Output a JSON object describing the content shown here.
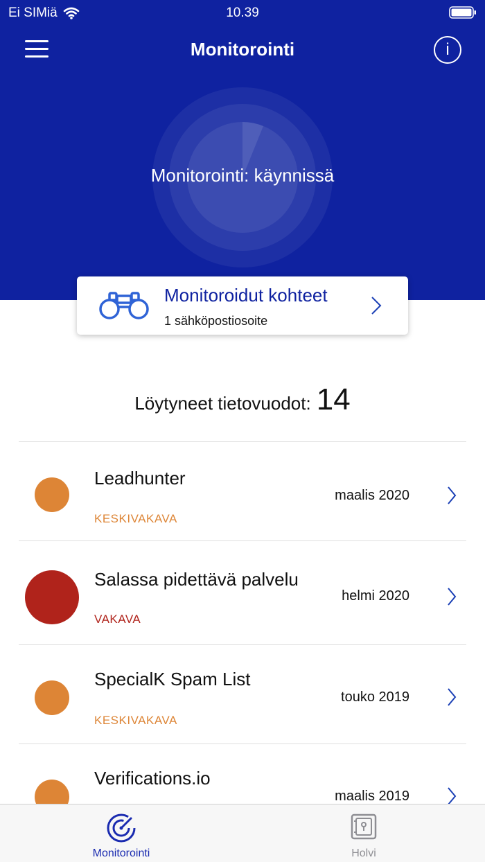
{
  "status_bar": {
    "carrier": "Ei SIMiä",
    "time": "10.39"
  },
  "nav": {
    "title": "Monitorointi"
  },
  "monitoring": {
    "status_text": "Monitorointi: käynnissä"
  },
  "monitored_items": {
    "title": "Monitoroidut kohteet",
    "subtitle": "1 sähköpostiosoite"
  },
  "breaches": {
    "label": "Löytyneet tietovuodot:",
    "count": "14",
    "items": [
      {
        "name": "Leadhunter",
        "severity": "KESKIVAKAVA",
        "date": "maalis 2020",
        "severity_color": "#dd8536"
      },
      {
        "name": "Salassa pidettävä palvelu",
        "severity": "VAKAVA",
        "date": "helmi 2020",
        "severity_color": "#b0231b"
      },
      {
        "name": "SpecialK Spam List",
        "severity": "KESKIVAKAVA",
        "date": "touko 2019",
        "severity_color": "#dd8536"
      },
      {
        "name": "Verifications.io",
        "severity": "",
        "date": "maalis 2019",
        "severity_color": "#dd8536"
      }
    ]
  },
  "tabs": [
    {
      "label": "Monitorointi",
      "active": true
    },
    {
      "label": "Holvi",
      "active": false
    }
  ],
  "colors": {
    "brand": "#0f22a0",
    "medium": "#dd8536",
    "severe": "#b0231b",
    "inactive_tab": "#8e8e93"
  }
}
